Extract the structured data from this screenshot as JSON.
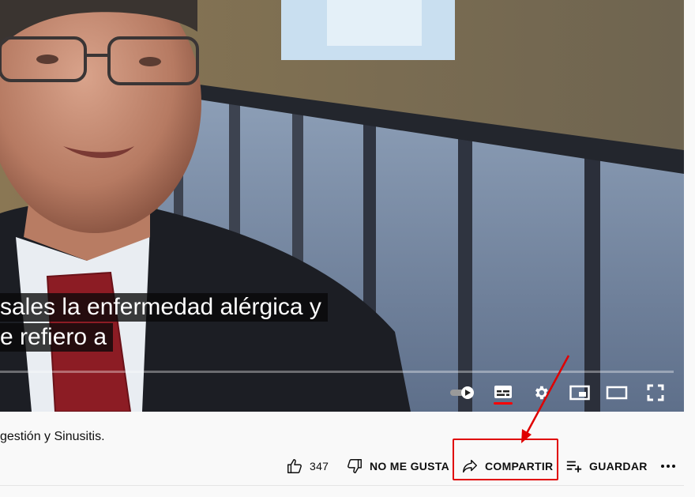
{
  "video": {
    "captions": [
      "sales la enfermedad alérgica y",
      "e refiero a"
    ],
    "progress_fraction": 0.0,
    "controls": [
      {
        "name": "autoplay-toggle-icon"
      },
      {
        "name": "subtitles-icon",
        "active_color": "#ff0000"
      },
      {
        "name": "settings-gear-icon"
      },
      {
        "name": "miniplayer-icon"
      },
      {
        "name": "theater-mode-icon"
      },
      {
        "name": "fullscreen-icon"
      }
    ]
  },
  "description": {
    "text": "gestión y Sinusitis."
  },
  "actions": {
    "like_count": "347",
    "dislike_label": "NO ME GUSTA",
    "share_label": "COMPARTIR",
    "save_label": "GUARDAR",
    "more_icon": "more-horizontal-icon"
  },
  "annotation": {
    "highlight_color": "#e00000",
    "target": "share-button"
  }
}
